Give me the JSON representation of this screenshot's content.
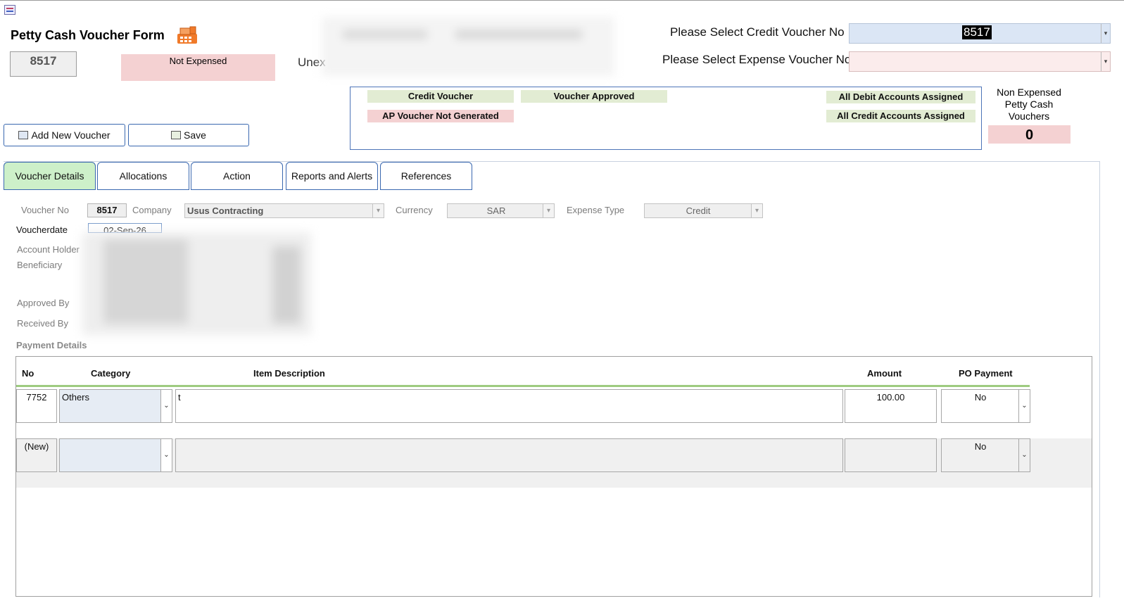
{
  "header": {
    "title": "Petty Cash Voucher Form",
    "voucher_no": "8517",
    "status": "Not Expensed",
    "unexpensed_label": "Unex"
  },
  "selectors": {
    "credit_label": "Please Select  Credit Voucher No",
    "credit_value": "8517",
    "expense_label": "Please Select Expense Voucher No",
    "expense_value": ""
  },
  "flags": {
    "credit_voucher": "Credit Voucher",
    "voucher_approved": "Voucher Approved",
    "ap_not_generated": "AP Voucher Not Generated",
    "debit_assigned": "All Debit Accounts Assigned",
    "credit_assigned": "All Credit Accounts Assigned"
  },
  "non_expensed": {
    "label": "Non Expensed Petty Cash Vouchers",
    "count": "0"
  },
  "buttons": {
    "add_new": "Add New Voucher",
    "save": "Save"
  },
  "tabs": [
    "Voucher Details",
    "Allocations",
    "Action",
    "Reports and Alerts",
    "References"
  ],
  "details": {
    "voucher_no_label": "Voucher No",
    "voucher_no": "8517",
    "company_label": "Company",
    "company": "Usus Contracting",
    "currency_label": "Currency",
    "currency": "SAR",
    "expense_type_label": "Expense Type",
    "expense_type": "Credit",
    "voucherdate_label": "Voucherdate",
    "voucherdate": "02-Sep-26",
    "account_holder_label": "Account Holder",
    "beneficiary_label": "Beneficiary",
    "approved_by_label": "Approved By",
    "received_by_label": "Received By",
    "payment_details_label": "Payment Details"
  },
  "payment_table": {
    "columns": [
      "No",
      "Category",
      "Item Description",
      "Amount",
      "PO Payment"
    ],
    "rows": [
      {
        "no": "7752",
        "category": "Others",
        "description": "t",
        "amount": "100.00",
        "po_payment": "No"
      },
      {
        "no": "(New)",
        "category": "",
        "description": "",
        "amount": "",
        "po_payment": "No"
      }
    ]
  },
  "colors": {
    "status_pink": "#f4d1d2",
    "status_green": "#e2ecd3",
    "active_tab": "#cdf0c9",
    "border_blue": "#3a68b0"
  }
}
